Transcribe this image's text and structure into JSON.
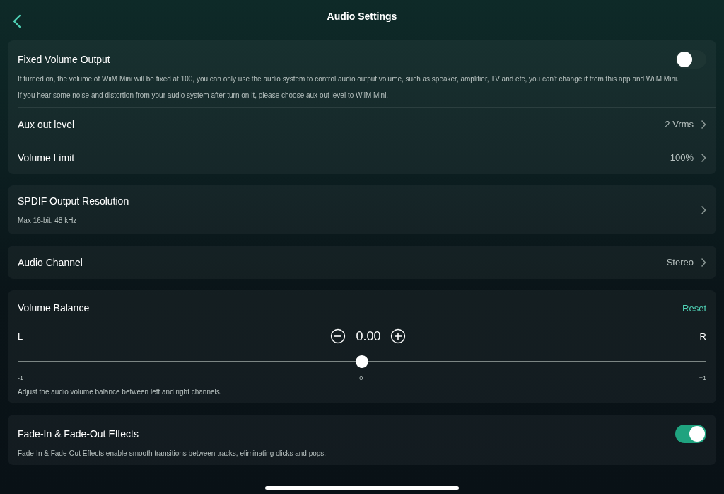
{
  "header": {
    "title": "Audio Settings"
  },
  "cards": [
    {
      "rows": [
        {
          "kind": "toggle",
          "label": "Fixed Volume Output",
          "on": false,
          "notes": [
            "If turned on, the volume of WiiM Mini will be fixed at 100, you can only use the audio system to control audio output volume, such as speaker, amplifier, TV and etc, you can't change it from this app and WiiM Mini.",
            "If you hear some noise and distortion from your audio system after turn on it, please choose aux out level to WiiM Mini."
          ]
        },
        {
          "kind": "link",
          "label": "Aux out level",
          "value": "2 Vrms"
        },
        {
          "kind": "link",
          "label": "Volume Limit",
          "value": "100%"
        }
      ]
    },
    {
      "rows": [
        {
          "kind": "link",
          "label": "SPDIF Output Resolution",
          "subtitle": "Max 16-bit, 48 kHz"
        }
      ]
    },
    {
      "rows": [
        {
          "kind": "link",
          "label": "Audio Channel",
          "value": "Stereo"
        }
      ]
    },
    {
      "rows": [
        {
          "kind": "balance",
          "label": "Volume Balance",
          "action": "Reset",
          "left": "L",
          "right": "R",
          "reading": "0.00",
          "level": 0.5,
          "ticks": [
            "-1",
            "0",
            "+1"
          ],
          "note": "Adjust the audio volume balance between left and right channels."
        }
      ]
    },
    {
      "rows": [
        {
          "kind": "toggle",
          "label": "Fade-In & Fade-Out Effects",
          "on": true,
          "notes": [
            "Fade-In & Fade-Out Effects enable smooth transitions between tracks, eliminating clicks and pops."
          ]
        }
      ]
    }
  ]
}
